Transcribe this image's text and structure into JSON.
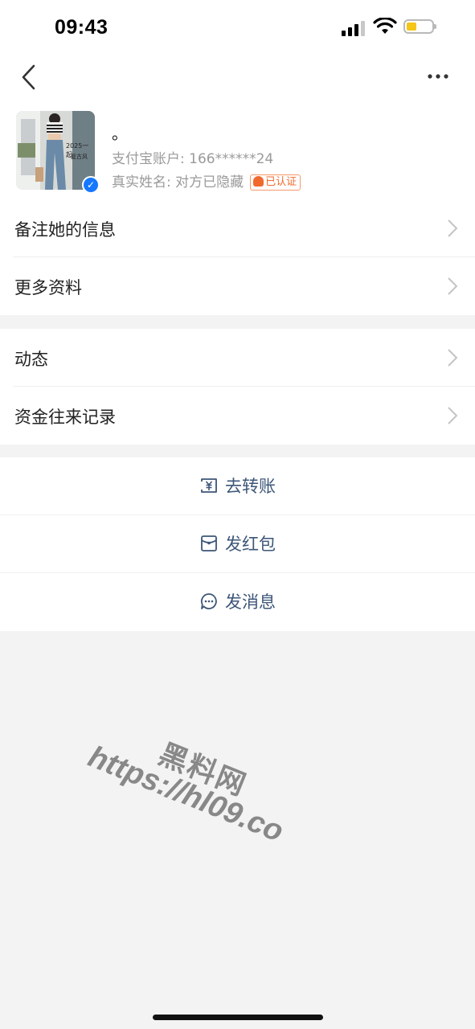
{
  "status_bar": {
    "time": "09:43"
  },
  "profile": {
    "nickname": "。",
    "account": "支付宝账户: 166******24",
    "real_name": "真实姓名: 对方已隐藏",
    "verified_badge": "已认证",
    "avatar_text_1": "2025一起",
    "avatar_text_2": "复古风"
  },
  "menu_group_1": [
    {
      "label": "备注她的信息"
    },
    {
      "label": "更多资料"
    }
  ],
  "menu_group_2": [
    {
      "label": "动态"
    },
    {
      "label": "资金往来记录"
    }
  ],
  "actions": [
    {
      "label": "去转账",
      "icon": "transfer-icon"
    },
    {
      "label": "发红包",
      "icon": "red-packet-icon"
    },
    {
      "label": "发消息",
      "icon": "message-icon"
    }
  ],
  "watermark": {
    "line1": "黑料网",
    "line2": "https://hl09.co"
  },
  "colors": {
    "accent_text": "#3d5678",
    "verified_blue": "#1677ff",
    "badge_orange": "#f06a2d",
    "battery_yellow": "#f5c518"
  }
}
